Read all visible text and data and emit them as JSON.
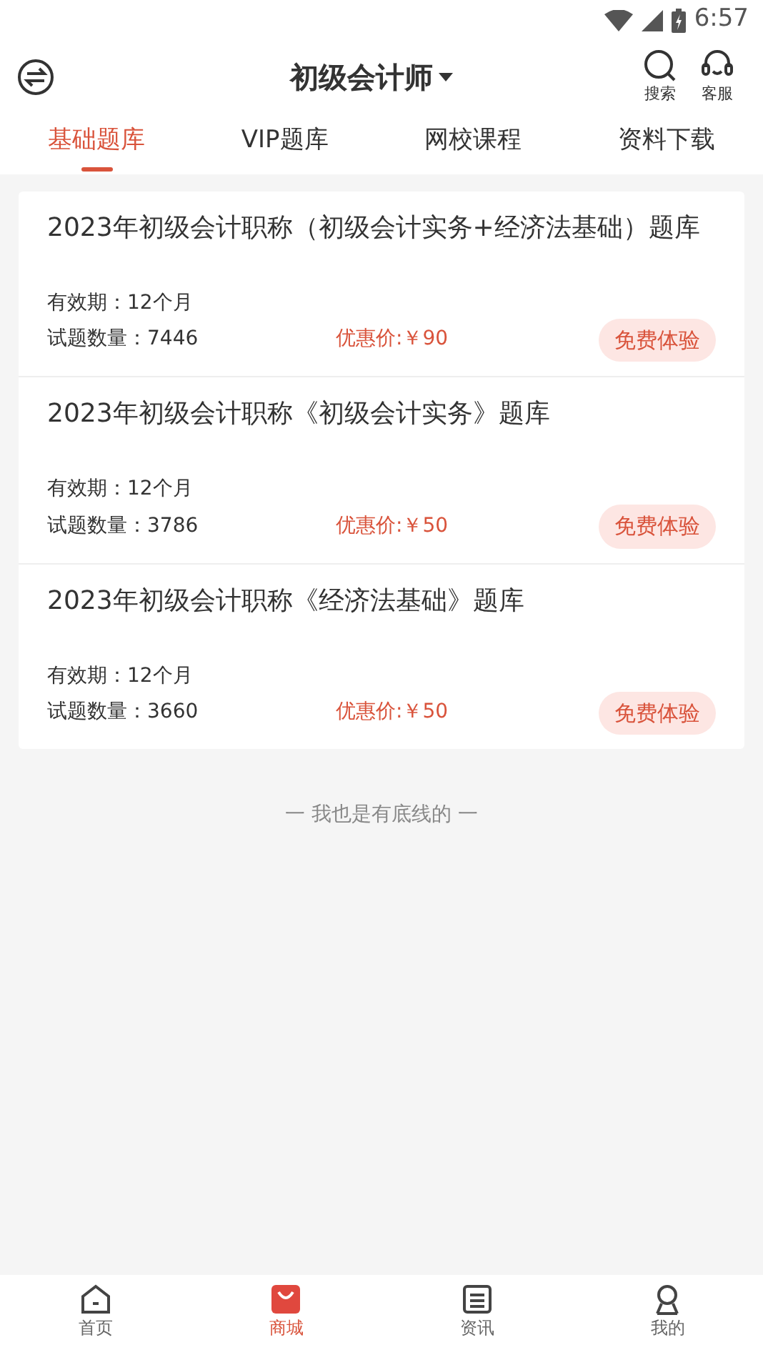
{
  "status_bar": {
    "time": "6:57"
  },
  "header": {
    "title": "初级会计师",
    "actions": [
      {
        "kind": "search",
        "label": "搜索"
      },
      {
        "kind": "service",
        "label": "客服"
      }
    ]
  },
  "tabs": [
    {
      "label": "基础题库",
      "selected": true
    },
    {
      "label": "VIP题库",
      "selected": false
    },
    {
      "label": "网校课程",
      "selected": false
    },
    {
      "label": "资料下载",
      "selected": false
    }
  ],
  "banks": [
    {
      "title": "2023年初级会计职称（初级会计实务+经济法基础）题库",
      "validity": "有效期：12个月",
      "count": "试题数量：7446",
      "price": "优惠价:￥90",
      "button": "免费体验"
    },
    {
      "title": "2023年初级会计职称《初级会计实务》题库",
      "validity": "有效期：12个月",
      "count": "试题数量：3786",
      "price": "优惠价:￥50",
      "button": "免费体验"
    },
    {
      "title": "2023年初级会计职称《经济法基础》题库",
      "validity": "有效期：12个月",
      "count": "试题数量：3660",
      "price": "优惠价:￥50",
      "button": "免费体验"
    }
  ],
  "end_note": "一  我也是有底线的  一",
  "bottom_nav": [
    {
      "kind": "home",
      "label": "首页",
      "highlighted": false
    },
    {
      "kind": "shop",
      "label": "商城",
      "highlighted": true
    },
    {
      "kind": "news",
      "label": "资讯",
      "highlighted": false
    },
    {
      "kind": "profile",
      "label": "我的",
      "highlighted": false
    }
  ]
}
